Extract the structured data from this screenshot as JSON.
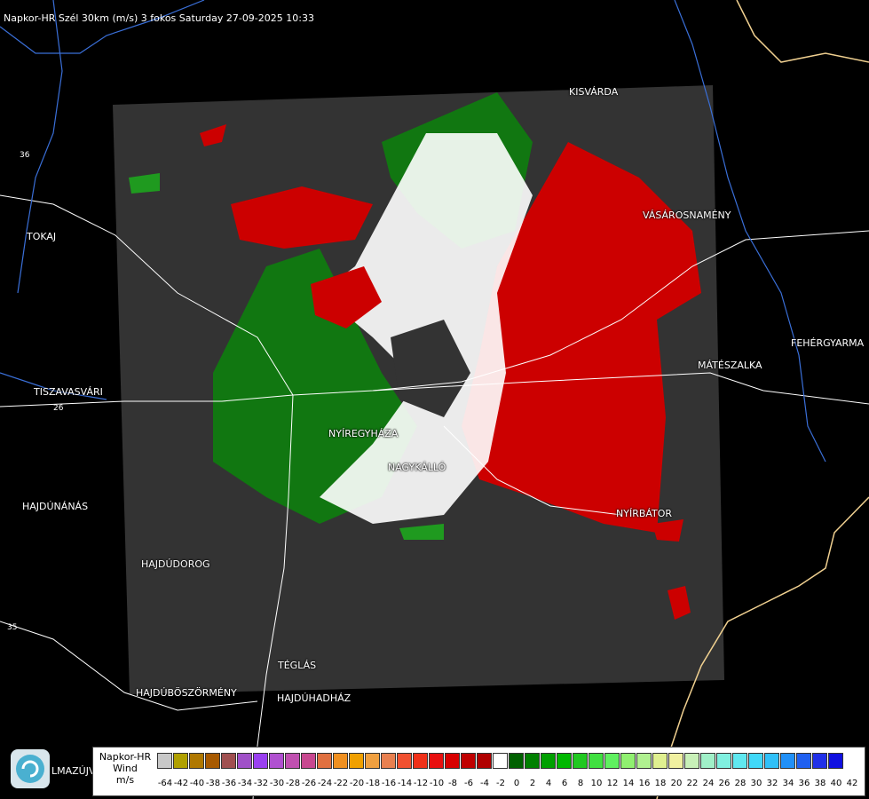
{
  "title": "Napkor-HR Szél 30km (m/s) 3 fokos Saturday 27-09-2025 10:33",
  "colors": {
    "background": "#000000",
    "scan_area": "#333333",
    "outflow": "#cc0000",
    "inflow": "#117711",
    "near_zero": "#ffffff",
    "border": "#f0d090",
    "river": "#3a6fd8",
    "boundary": "#ffffff"
  },
  "cities": [
    {
      "name": "KISVÁRDA"
    },
    {
      "name": "TOKAJ"
    },
    {
      "name": "VÁSÁROSNAMÉNY"
    },
    {
      "name": "FEHÉRGYARMA"
    },
    {
      "name": "MÁTÉSZALKA"
    },
    {
      "name": "TISZAVASVÁRI"
    },
    {
      "name": "NYÍREGYHÁZA"
    },
    {
      "name": "NAGYKÁLLÓ"
    },
    {
      "name": "HAJDÚNÁNÁS"
    },
    {
      "name": "NYÍRBÁTOR"
    },
    {
      "name": "HAJDÚDOROG"
    },
    {
      "name": "TÉGLÁS"
    },
    {
      "name": "HAJDÚBÖSZÖRMÉNY"
    },
    {
      "name": "HAJDÚHADHÁZ"
    },
    {
      "name": "HAJDÚNÁNÁS"
    }
  ],
  "road_numbers": [
    "36",
    "35",
    "26"
  ],
  "logo_label": "LMAZÚJVÁR",
  "legend": {
    "line1": "Napkor-HR",
    "line2": "Wind",
    "line3": "m/s",
    "ticks": [
      "-64",
      "-42",
      "-40",
      "-38",
      "-36",
      "-34",
      "-32",
      "-30",
      "-28",
      "-26",
      "-24",
      "-22",
      "-20",
      "-18",
      "-16",
      "-14",
      "-12",
      "-10",
      "-8",
      "-6",
      "-4",
      "-2",
      "0",
      "2",
      "4",
      "6",
      "8",
      "10",
      "12",
      "14",
      "16",
      "18",
      "20",
      "22",
      "24",
      "26",
      "28",
      "30",
      "32",
      "34",
      "36",
      "38",
      "40",
      "42"
    ],
    "swatch_colors": [
      "#c8c8c8",
      "#b0a000",
      "#b07800",
      "#a85a00",
      "#a05050",
      "#a050c8",
      "#9a40f0",
      "#b050d0",
      "#c050b0",
      "#c84890",
      "#e07040",
      "#f09020",
      "#f0a000",
      "#f0a040",
      "#e88050",
      "#f05030",
      "#f03018",
      "#e81010",
      "#d80000",
      "#c00000",
      "#b00000",
      "#ffffff",
      "#006000",
      "#008000",
      "#00a000",
      "#00b800",
      "#20c820",
      "#40e040",
      "#60f060",
      "#90f070",
      "#b0f090",
      "#e0f090",
      "#f0f0a0",
      "#c8f0b8",
      "#a0f0c8",
      "#80f0e0",
      "#60e8f0",
      "#40d8f8",
      "#30c0f8",
      "#2090f8",
      "#2060f0",
      "#2030e8",
      "#1010e0"
    ]
  }
}
